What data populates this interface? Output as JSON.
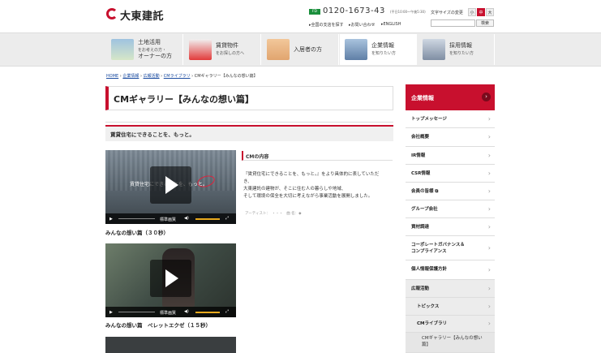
{
  "header": {
    "logo_text": "大東建託",
    "freedial": "FD",
    "phone": "0120-1673-43",
    "hours": "(平日10:00〜午後5:30)",
    "font_size_label": "文字サイズの変更",
    "font_sizes": [
      "小",
      "中",
      "大"
    ],
    "links": [
      "全国の支店を探す",
      "お問い合わせ",
      "ENGLISH"
    ],
    "search_placeholder": "",
    "search_button": "検索"
  },
  "nav": [
    {
      "title": "土地活用",
      "sub": "をお考えの方・",
      "title2": "オーナーの方"
    },
    {
      "title": "賃貸物件",
      "sub": "をお探しの方へ"
    },
    {
      "title": "入居者の方",
      "sub": ""
    },
    {
      "title": "企業情報",
      "sub": "を知りたい方"
    },
    {
      "title": "採用情報",
      "sub": "を知りたい方"
    }
  ],
  "breadcrumb": [
    "HOME",
    "企業情報",
    "広報活動",
    "CMライブラリ",
    "CMギャラリー【みんなの想い篇】"
  ],
  "page_title": "CMギャラリー【みんなの想い篇】",
  "sub_heading": "賃貸住宅にできることを、もっと。",
  "videos": [
    {
      "caption": "みんなの想い篇（３０秒）",
      "overlay": "賃貸住宅にできることを、もっと。",
      "quality": "標準画質"
    },
    {
      "caption": "みんなの想い篇　ペレットエクゼ（１５秒）",
      "quality": "標準画質"
    }
  ],
  "cm": {
    "heading": "CMの内容",
    "lines": [
      "『賃貸住宅にできることを、もっと。』をより具体的に表していただ",
      "き、",
      "大東建託の建物が、そこに住む人の暮らしや地域、",
      "そして環境の保全を大切に考えながら事業活動を展開しました。"
    ],
    "artist": "アーティスト：　・・・　曲 名：◆"
  },
  "sidebar": {
    "heading": "企業情報",
    "items": [
      {
        "label": "トップメッセージ"
      },
      {
        "label": "会社概要"
      },
      {
        "label": "IR情報"
      },
      {
        "label": "CSR情報"
      },
      {
        "label": "会員の皆様 ⧉"
      },
      {
        "label": "グループ会社"
      },
      {
        "label": "資材調達"
      },
      {
        "label": "コーポレートガバナンス＆",
        "label2": "コンプライアンス"
      },
      {
        "label": "個人情報保護方針"
      },
      {
        "label": "広報活動"
      },
      {
        "label": "トピックス"
      },
      {
        "label": "CMライブラリ"
      },
      {
        "label": "CMギャラリー【みんなの想い",
        "label2": "篇】"
      }
    ]
  },
  "colors": {
    "brand": "#c8102e",
    "freedial": "#1a8f3c",
    "link": "#1a4ba0"
  }
}
